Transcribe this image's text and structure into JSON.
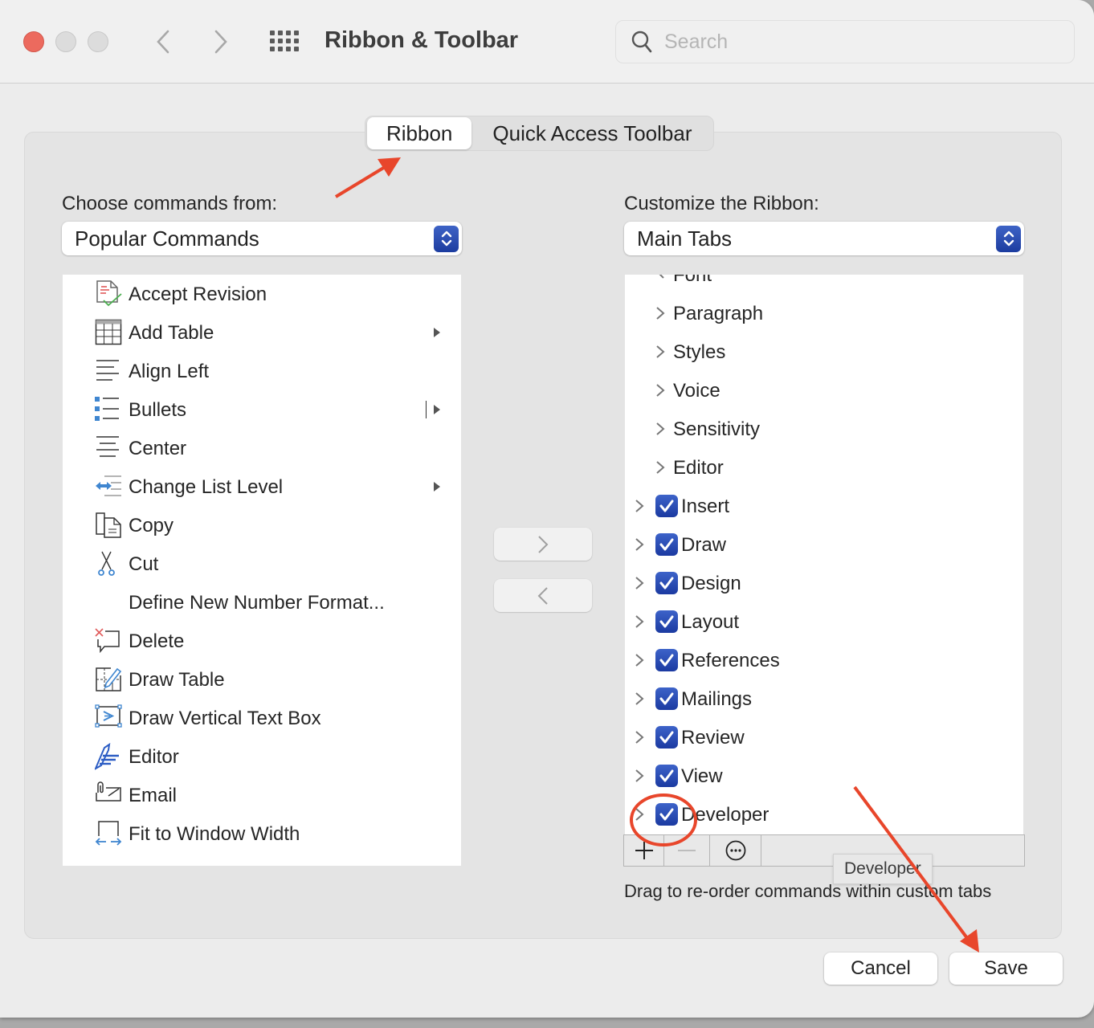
{
  "window": {
    "title": "Ribbon & Toolbar",
    "search_placeholder": "Search",
    "search_value": ""
  },
  "tabs": [
    {
      "label": "Ribbon",
      "active": true
    },
    {
      "label": "Quick Access Toolbar",
      "active": false
    }
  ],
  "left": {
    "label": "Choose commands from:",
    "selected": "Popular Commands",
    "commands": [
      {
        "label": "Accept Revision",
        "icon": "accept-revision-icon",
        "submenu": false
      },
      {
        "label": "Add Table",
        "icon": "table-icon",
        "submenu": true
      },
      {
        "label": "Align Left",
        "icon": "align-left-icon",
        "submenu": false
      },
      {
        "label": "Bullets",
        "icon": "bullets-icon",
        "submenu": true,
        "split": true
      },
      {
        "label": "Center",
        "icon": "align-center-icon",
        "submenu": false
      },
      {
        "label": "Change List Level",
        "icon": "change-list-level-icon",
        "submenu": true
      },
      {
        "label": "Copy",
        "icon": "copy-icon",
        "submenu": false
      },
      {
        "label": "Cut",
        "icon": "scissors-icon",
        "submenu": false
      },
      {
        "label": "Define New Number Format...",
        "icon": "",
        "submenu": false
      },
      {
        "label": "Delete",
        "icon": "delete-comment-icon",
        "submenu": false
      },
      {
        "label": "Draw Table",
        "icon": "draw-table-icon",
        "submenu": false
      },
      {
        "label": "Draw Vertical Text Box",
        "icon": "vertical-text-box-icon",
        "submenu": false
      },
      {
        "label": "Editor",
        "icon": "editor-pen-icon",
        "submenu": false
      },
      {
        "label": "Email",
        "icon": "email-attachment-icon",
        "submenu": false
      },
      {
        "label": "Fit to Window Width",
        "icon": "fit-width-icon",
        "submenu": false
      }
    ]
  },
  "transfer": {
    "add_icon": "chevron-right-icon",
    "remove_icon": "chevron-left-icon"
  },
  "right": {
    "label": "Customize the Ribbon:",
    "selected": "Main Tabs",
    "groups": [
      {
        "label": "Font"
      },
      {
        "label": "Paragraph"
      },
      {
        "label": "Styles"
      },
      {
        "label": "Voice"
      },
      {
        "label": "Sensitivity"
      },
      {
        "label": "Editor"
      }
    ],
    "tabs": [
      {
        "label": "Insert",
        "checked": true
      },
      {
        "label": "Draw",
        "checked": true
      },
      {
        "label": "Design",
        "checked": true
      },
      {
        "label": "Layout",
        "checked": true
      },
      {
        "label": "References",
        "checked": true
      },
      {
        "label": "Mailings",
        "checked": true
      },
      {
        "label": "Review",
        "checked": true
      },
      {
        "label": "View",
        "checked": true
      },
      {
        "label": "Developer",
        "checked": true
      }
    ],
    "tooltip": "Developer",
    "hint": "Drag to re-order commands within custom tabs"
  },
  "footer": {
    "cancel": "Cancel",
    "save": "Save"
  },
  "colors": {
    "accent": "#2a4bb4",
    "annotation": "#e8462b",
    "close": "#ec6a5e"
  }
}
